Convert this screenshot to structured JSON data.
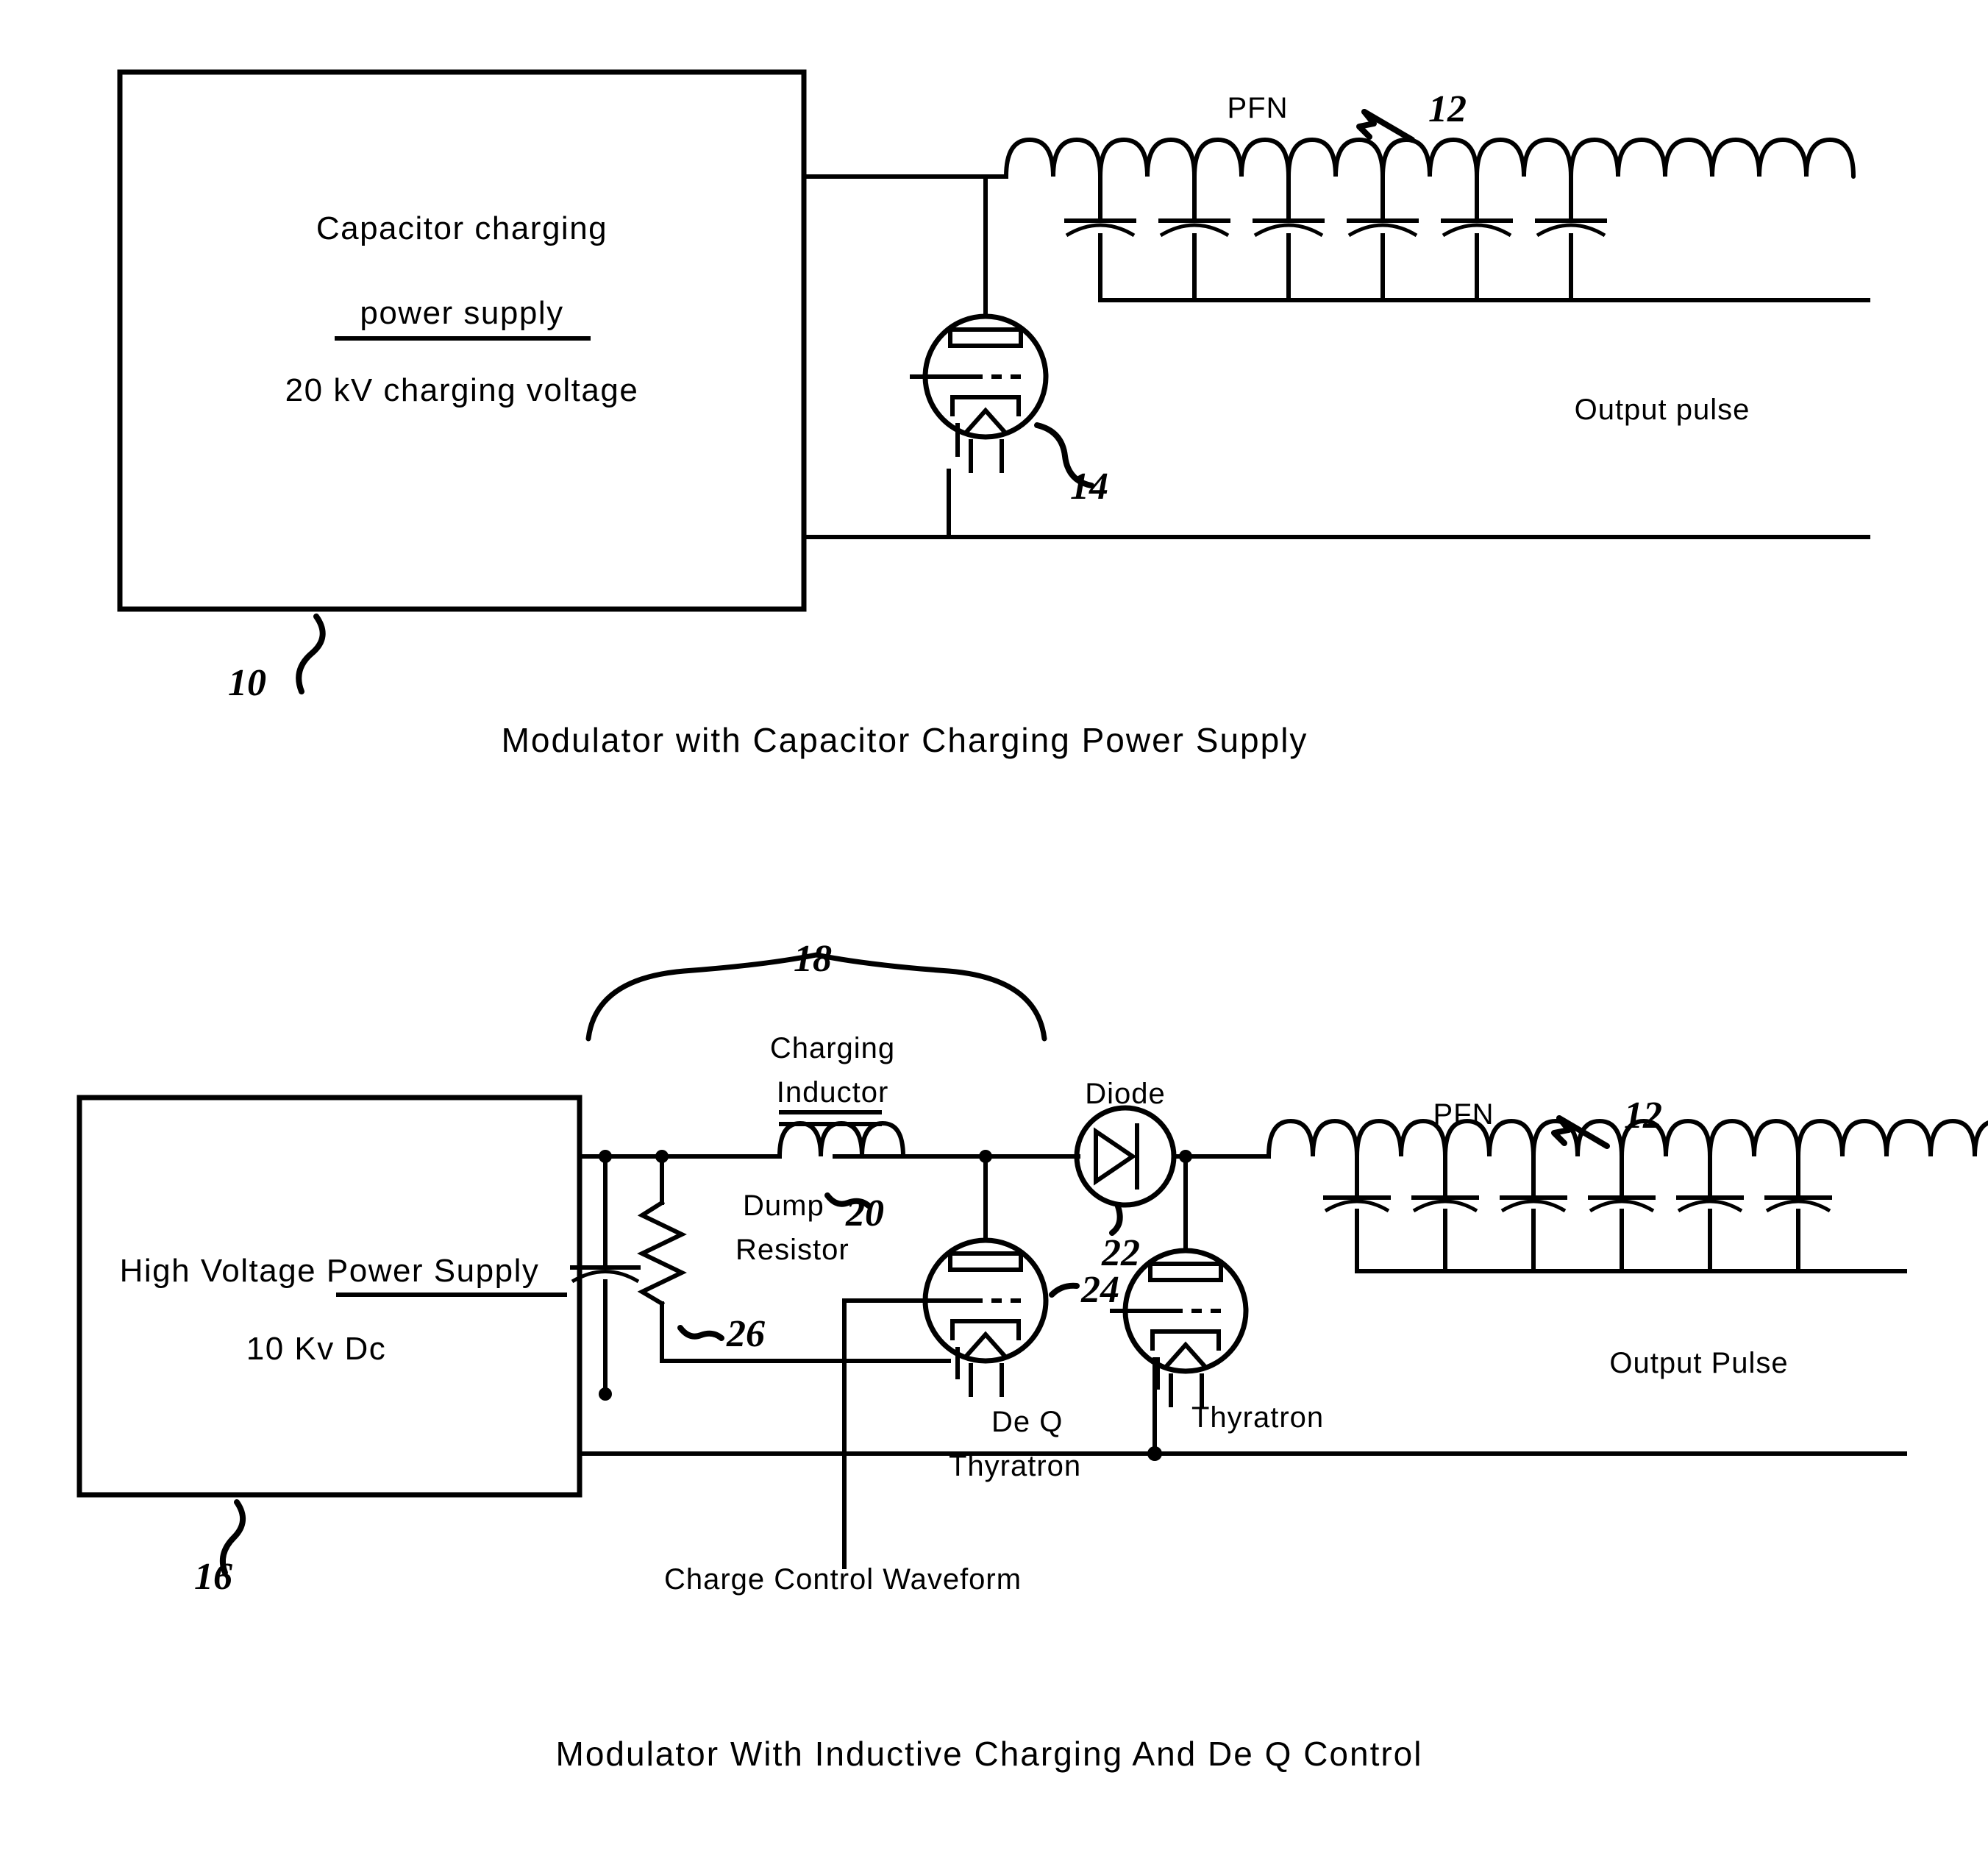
{
  "figure1": {
    "supply_box": {
      "line1": "Capacitor charging",
      "line2": "power supply",
      "line3": "20 kV charging voltage"
    },
    "pfn_label": "PFN",
    "output_label": "Output pulse",
    "refs": {
      "supply": "10",
      "pfn": "12",
      "thyratron": "14"
    },
    "caption": "Modulator with Capacitor Charging Power Supply"
  },
  "figure2": {
    "supply_box": {
      "line1": "High Voltage Power Supply",
      "line2": "10 Kv Dc"
    },
    "charging_inductor_label_line1": "Charging",
    "charging_inductor_label_line2": "Inductor",
    "diode_label": "Diode",
    "dump_resistor_line1": "Dump",
    "dump_resistor_line2": "Resistor",
    "deq_label_line1": "De Q",
    "deq_label_line2": "Thyratron",
    "thyratron_label": "Thyratron",
    "charge_control_label": "Charge Control Waveform",
    "pfn_label": "PFN",
    "output_label": "Output Pulse",
    "refs": {
      "supply": "16",
      "charging_section": "18",
      "inductor": "20",
      "diode": "22",
      "deq_thyratron": "24",
      "dump_resistor": "26",
      "pfn": "12"
    },
    "caption": "Modulator With Inductive Charging And De Q Control"
  },
  "colors": {
    "ink": "#000000",
    "paper": "#ffffff"
  }
}
